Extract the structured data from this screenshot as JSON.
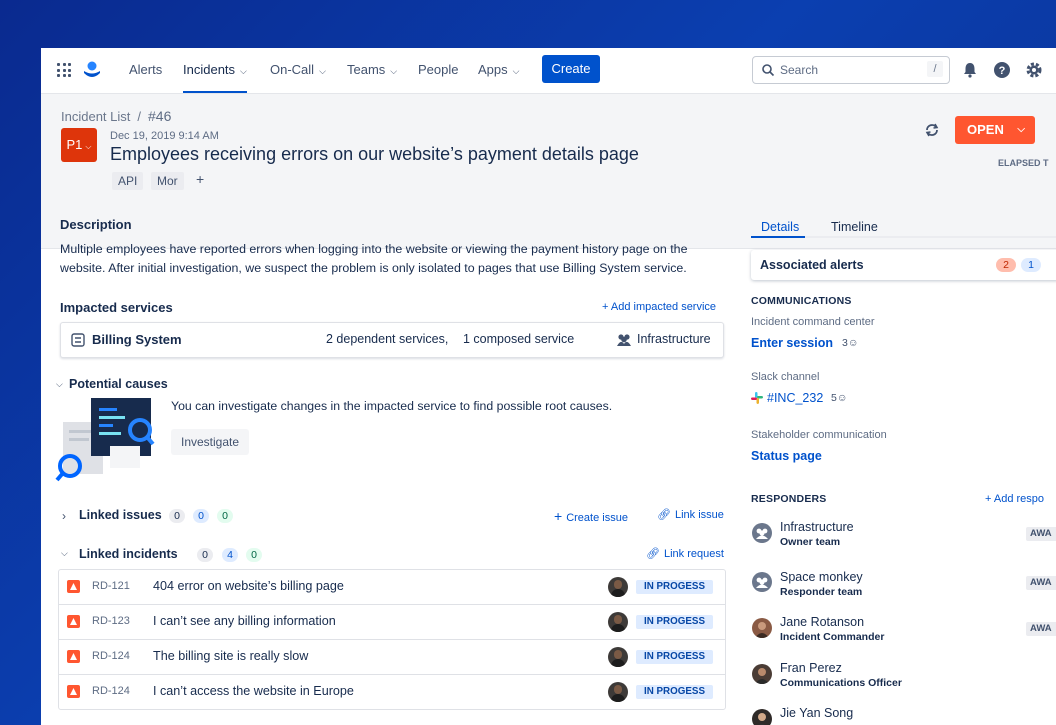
{
  "nav": {
    "items": [
      {
        "label": "Alerts",
        "dropdown": false
      },
      {
        "label": "Incidents",
        "dropdown": true,
        "active": true
      },
      {
        "label": "On-Call",
        "dropdown": true
      },
      {
        "label": "Teams",
        "dropdown": true
      },
      {
        "label": "People",
        "dropdown": false
      },
      {
        "label": "Apps",
        "dropdown": true
      }
    ],
    "create_label": "Create",
    "search_placeholder": "Search",
    "search_shortcut": "/",
    "icons": [
      "app-switcher-icon",
      "product-logo-icon",
      "search-icon",
      "bell-icon",
      "help-icon",
      "gear-icon"
    ]
  },
  "header": {
    "breadcrumb_list": "Incident List",
    "breadcrumb_sep": "/",
    "breadcrumb_id": "#46",
    "priority": "P1",
    "date": "Dec 19, 2019 9:14 AM",
    "title": "Employees receiving errors on our website’s payment details page",
    "tags": [
      "API",
      "Mor"
    ],
    "add_tag": "+",
    "status_button": "OPEN",
    "elapsed_label": "ELAPSED T"
  },
  "description": {
    "heading": "Description",
    "text": "Multiple employees have reported errors when logging into the website or viewing the payment history page on the website. After initial investigation, we suspect the problem is only isolated to pages that use Billing System service."
  },
  "impacted": {
    "heading": "Impacted services",
    "add_link": "+ Add impacted service",
    "service_name": "Billing System",
    "dependent": "2 dependent services,",
    "composed": "1 composed service",
    "team": "Infrastructure"
  },
  "causes": {
    "heading": "Potential causes",
    "text": "You can investigate changes in the impacted service to find possible root causes.",
    "button": "Investigate"
  },
  "linked_issues": {
    "heading": "Linked issues",
    "counts": [
      "0",
      "0",
      "0"
    ],
    "create": "Create issue",
    "link": "Link issue"
  },
  "linked_incidents": {
    "heading": "Linked incidents",
    "counts": [
      "0",
      "4",
      "0"
    ],
    "link": "Link request",
    "rows": [
      {
        "key": "RD-121",
        "summary": "404 error on website’s billing page",
        "status": "IN PROGESS"
      },
      {
        "key": "RD-123",
        "summary": "I can’t see any billing information",
        "status": "IN PROGESS"
      },
      {
        "key": "RD-124",
        "summary": "The billing site is really slow",
        "status": "IN PROGESS"
      },
      {
        "key": "RD-124",
        "summary": "I can’t access the website in Europe",
        "status": "IN PROGESS"
      }
    ]
  },
  "side": {
    "tabs": [
      "Details",
      "Timeline"
    ],
    "assoc_label": "Associated alerts",
    "assoc_counts": [
      "2",
      "1"
    ],
    "comms_heading": "COMMUNICATIONS",
    "icc_label": "Incident command center",
    "icc_link": "Enter session",
    "icc_people": "3",
    "slack_label": "Slack channel",
    "slack_link": "#INC_232",
    "slack_people": "5",
    "stake_label": "Stakeholder communication",
    "stake_link": "Status page",
    "responders_heading": "RESPONDERS",
    "add_responder": "+ Add respo",
    "responders": [
      {
        "name": "Infrastructure",
        "role": "Owner team",
        "badge": "AWA"
      },
      {
        "name": "Space monkey",
        "role": "Responder team",
        "badge": "AWA"
      },
      {
        "name": "Jane Rotanson",
        "role": "Incident Commander",
        "badge": "AWA"
      },
      {
        "name": "Fran Perez",
        "role": "Communications Officer",
        "badge": ""
      },
      {
        "name": "Jie Yan Song",
        "role": "",
        "badge": ""
      }
    ]
  },
  "colors": {
    "primary": "#0052cc",
    "danger": "#ff5630",
    "priority": "#de350b",
    "text": "#172b4d",
    "subtle": "#5e6c84"
  }
}
